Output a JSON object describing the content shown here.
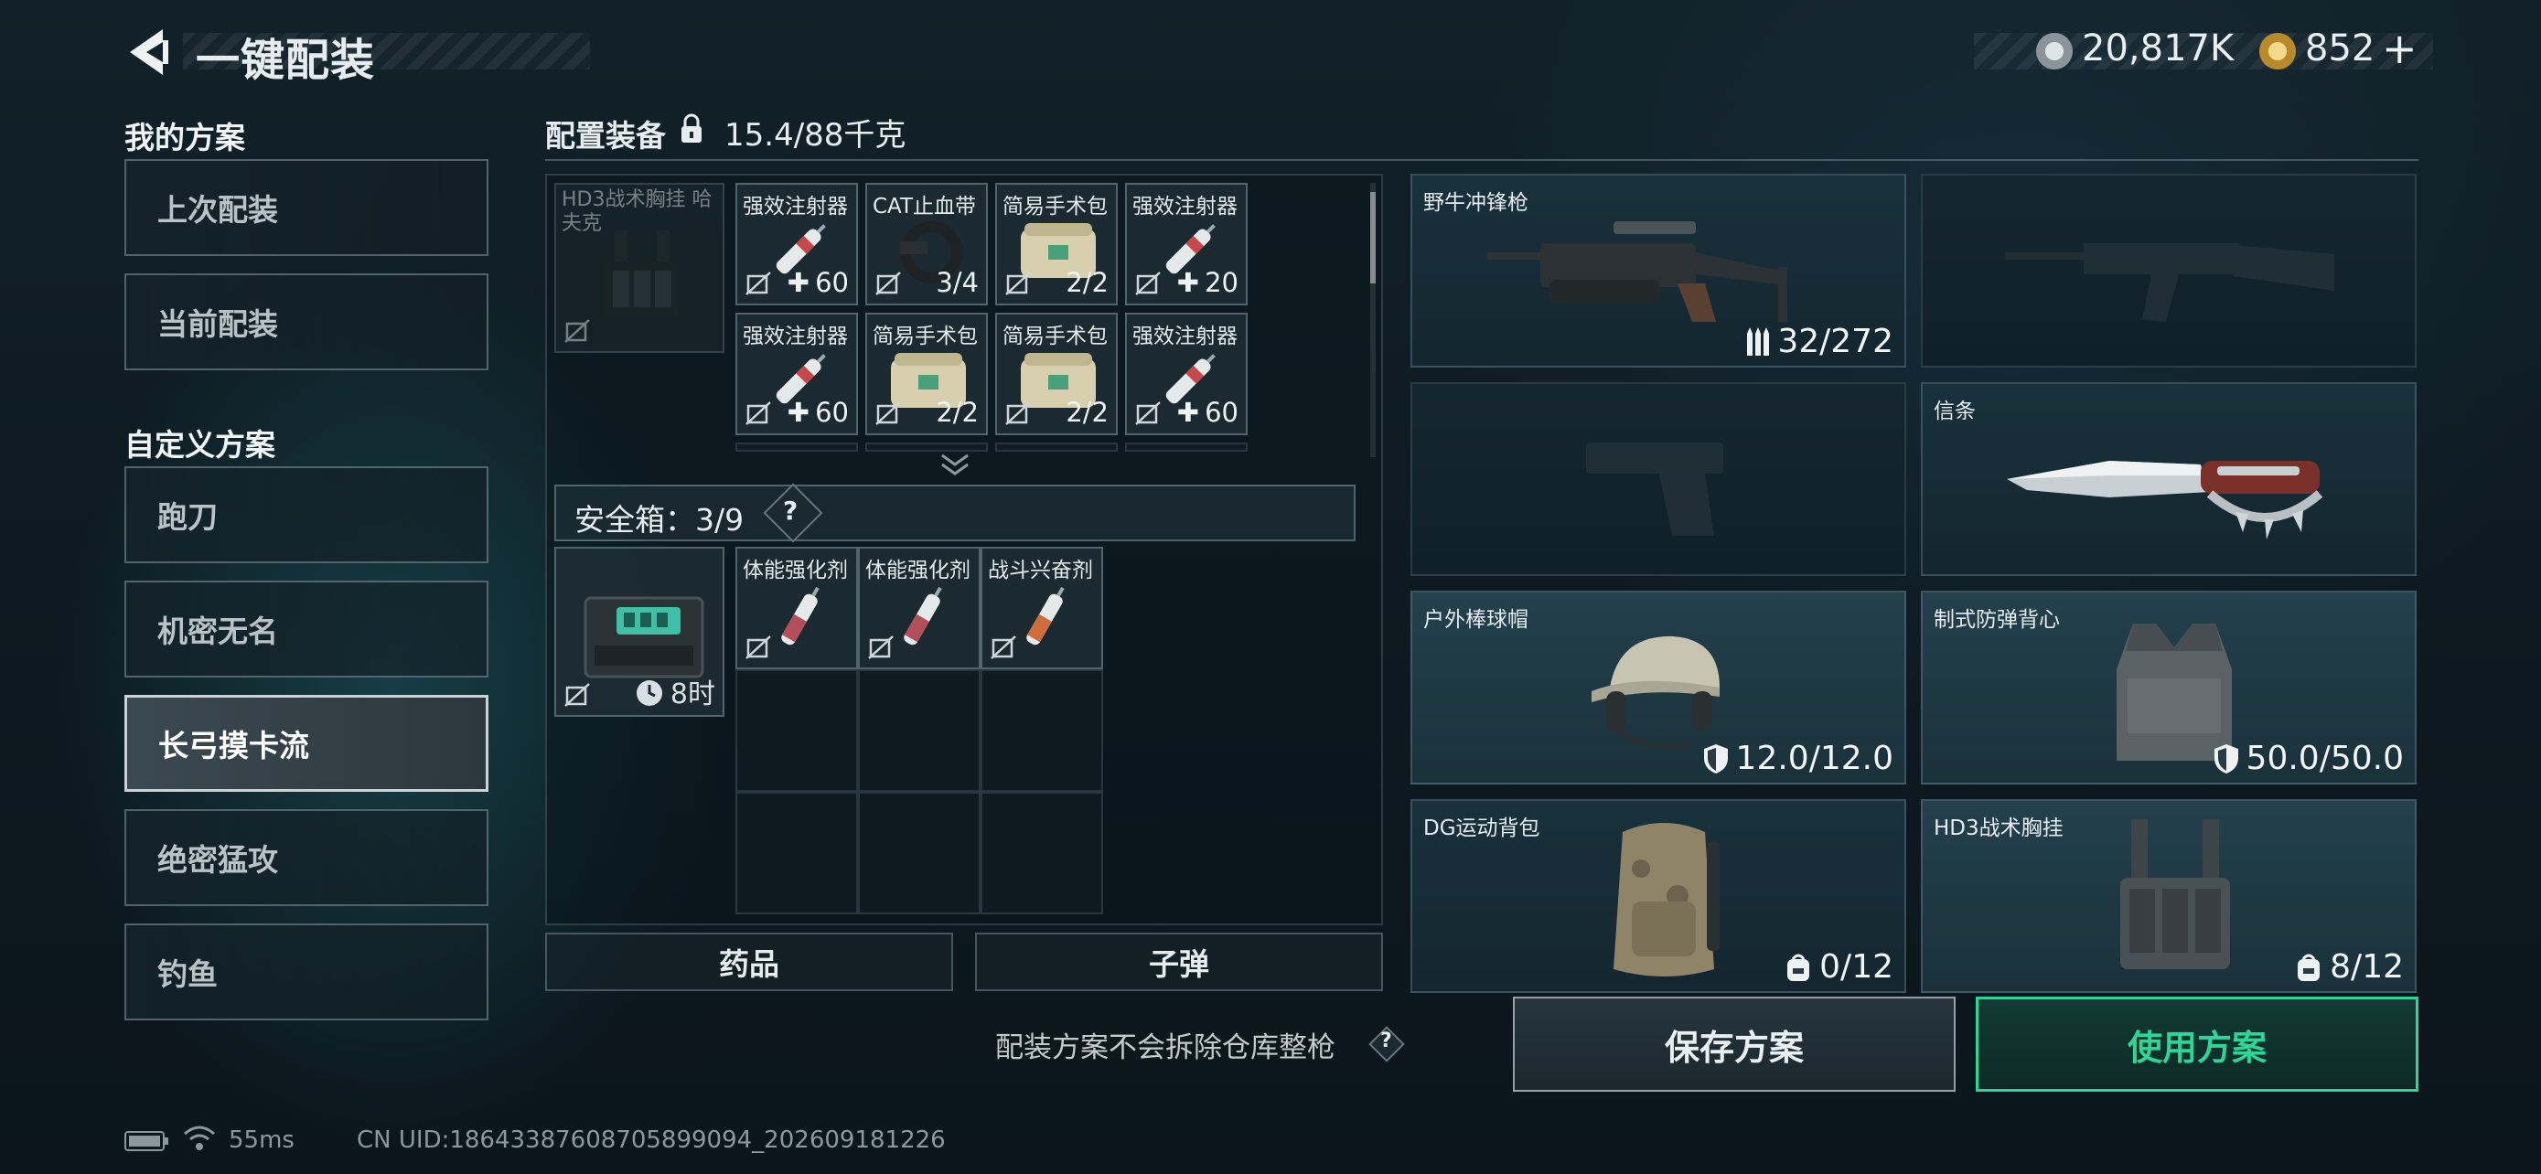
{
  "header": {
    "title": "一键配装",
    "currency": [
      {
        "icon": "silver-coin-icon",
        "value": "20,817K"
      },
      {
        "icon": "gold-coin-icon",
        "value": "852"
      }
    ]
  },
  "left": {
    "my_plans_title": "我的方案",
    "my_plans": [
      "上次配装",
      "当前配装"
    ],
    "custom_title": "自定义方案",
    "custom_plans": [
      "跑刀",
      "机密无名",
      "长弓摸卡流",
      "绝密猛攻",
      "钓鱼"
    ],
    "selected": "长弓摸卡流"
  },
  "equipment": {
    "title": "配置装备",
    "weight": "15.4/88千克",
    "rig_slot": {
      "name": "HD3战术胸挂 哈夫克"
    },
    "items": [
      {
        "name": "强效注射器",
        "qty": "60",
        "type": "heal"
      },
      {
        "name": "CAT止血带",
        "qty": "3/4",
        "type": "count"
      },
      {
        "name": "简易手术包",
        "qty": "2/2",
        "type": "count"
      },
      {
        "name": "强效注射器",
        "qty": "20",
        "type": "heal"
      },
      {
        "name": "强效注射器",
        "qty": "60",
        "type": "heal"
      },
      {
        "name": "简易手术包",
        "qty": "2/2",
        "type": "count"
      },
      {
        "name": "简易手术包",
        "qty": "2/2",
        "type": "count"
      },
      {
        "name": "强效注射器",
        "qty": "60",
        "type": "heal"
      }
    ],
    "safe_box": {
      "label": "安全箱：3/9",
      "help": "?",
      "time": "8时"
    },
    "safe_items": [
      {
        "name": "体能强化剂"
      },
      {
        "name": "体能强化剂"
      },
      {
        "name": "战斗兴奋剂"
      }
    ],
    "tabs": [
      "药品",
      "子弹"
    ]
  },
  "gear": {
    "primary": {
      "name": "野牛冲锋枪",
      "value": "32/272"
    },
    "knife": {
      "name": "信条"
    },
    "helmet": {
      "name": "户外棒球帽",
      "value": "12.0/12.0"
    },
    "armor": {
      "name": "制式防弹背心",
      "value": "50.0/50.0"
    },
    "backpack": {
      "name": "DG运动背包",
      "value": "0/12"
    },
    "rig": {
      "name": "HD3战术胸挂",
      "value": "8/12"
    }
  },
  "notice": "配装方案不会拆除仓库整枪",
  "actions": {
    "save": "保存方案",
    "use": "使用方案"
  },
  "status": {
    "ping": "55ms",
    "uid": "CN UID:18643387608705899094_202609181226"
  },
  "colors": {
    "accent": "#2fd596",
    "selected": "#c9d2d6"
  }
}
